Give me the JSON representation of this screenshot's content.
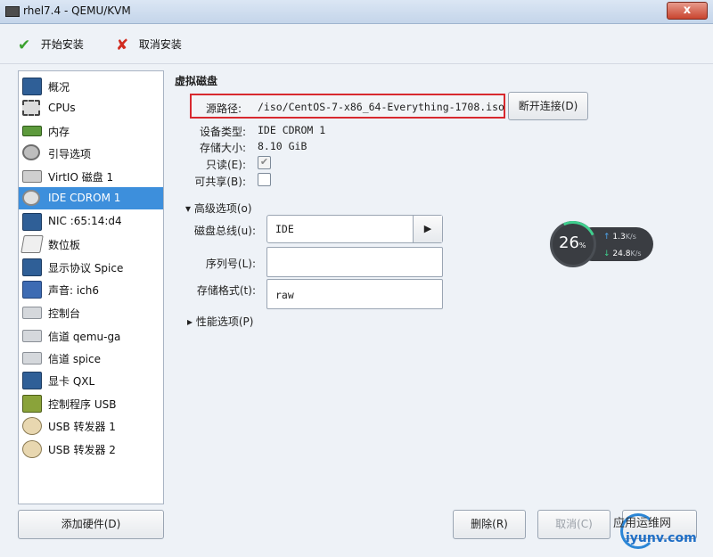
{
  "window": {
    "title": "rhel7.4 - QEMU/KVM",
    "close_glyph": "x"
  },
  "toolbar": {
    "start_label": "开始安装",
    "cancel_label": "取消安装"
  },
  "sidebar": {
    "items": [
      {
        "label": "概况",
        "icon": "monitor-icon"
      },
      {
        "label": "CPUs",
        "icon": "cpu-icon"
      },
      {
        "label": "内存",
        "icon": "memory-icon"
      },
      {
        "label": "引导选项",
        "icon": "boot-options-icon"
      },
      {
        "label": "VirtIO 磁盘 1",
        "icon": "disk-icon"
      },
      {
        "label": "IDE CDROM 1",
        "icon": "cdrom-icon",
        "selected": true
      },
      {
        "label": "NIC :65:14:d4",
        "icon": "nic-icon"
      },
      {
        "label": "数位板",
        "icon": "tablet-icon"
      },
      {
        "label": "显示协议 Spice",
        "icon": "display-icon"
      },
      {
        "label": "声音: ich6",
        "icon": "sound-icon"
      },
      {
        "label": "控制台",
        "icon": "console-icon"
      },
      {
        "label": "信道 qemu-ga",
        "icon": "channel-icon"
      },
      {
        "label": "信道 spice",
        "icon": "channel-icon"
      },
      {
        "label": "显卡 QXL",
        "icon": "video-card-icon"
      },
      {
        "label": "控制程序 USB",
        "icon": "usb-controller-icon"
      },
      {
        "label": "USB 转发器 1",
        "icon": "usb-redirector-icon"
      },
      {
        "label": "USB 转发器 2",
        "icon": "usb-redirector-icon"
      }
    ],
    "add_hardware_label": "添加硬件(D)"
  },
  "main": {
    "section_title": "虚拟磁盘",
    "source_label": "源路径:",
    "source_value": "/iso/CentOS-7-x86_64-Everything-1708.iso",
    "disconnect_label": "断开连接(D)",
    "device_type_label": "设备类型:",
    "device_type_value": "IDE CDROM 1",
    "storage_size_label": "存储大小:",
    "storage_size_value": "8.10 GiB",
    "readonly_label": "只读(E):",
    "readonly_checked": true,
    "shareable_label": "可共享(B):",
    "shareable_checked": false,
    "advanced_label": "高级选项(o)",
    "disk_bus_label": "磁盘总线(u):",
    "disk_bus_value": "IDE",
    "serial_label": "序列号(L):",
    "serial_value": "",
    "storage_format_label": "存储格式(t):",
    "storage_format_value": "raw",
    "performance_label": "性能选项(P)"
  },
  "net_widget": {
    "percent": "26",
    "percent_unit": "%",
    "up_value": "1.3",
    "up_unit": "K/s",
    "down_value": "24.8",
    "down_unit": "K/s",
    "arc_color": "#3fcf8e"
  },
  "buttons": {
    "remove_label": "删除(R)",
    "cancel_label": "取消(C)"
  },
  "watermark": {
    "top_text": "应用运维网",
    "bottom_text": "iyunv.com"
  },
  "colors": {
    "selection": "#3d8fdc",
    "highlight_border": "#d8292f"
  }
}
